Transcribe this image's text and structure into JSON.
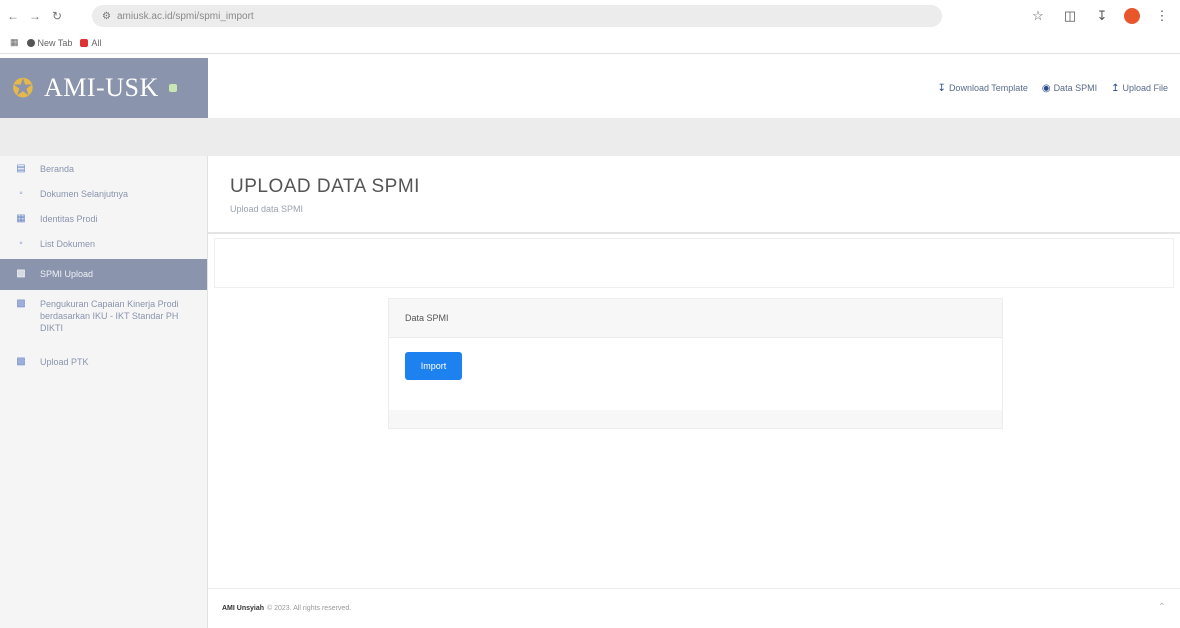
{
  "browser": {
    "url": "amiusk.ac.id/spmi/spmi_import",
    "bookmarks": [
      {
        "label": "New Tab"
      },
      {
        "label": "All"
      }
    ]
  },
  "brand": {
    "name": "AMI-USK"
  },
  "topnav": {
    "download_template": "Download Template",
    "data_spmi": "Data SPMI",
    "upload_file": "Upload File"
  },
  "sidebar": {
    "items": [
      {
        "label": "Beranda",
        "icon": "chart-icon"
      },
      {
        "label": "Dokumen Selanjutnya",
        "icon": "document-icon"
      },
      {
        "label": "Identitas Prodi",
        "icon": "id-card-icon"
      },
      {
        "label": "List Dokumen",
        "icon": "document-icon"
      },
      {
        "label": "SPMI Upload",
        "icon": "calendar-icon"
      },
      {
        "label": "Pengukuran Capaian Kinerja Prodi berdasarkan IKU - IKT Standar PH DIKTI",
        "icon": "calendar-icon"
      },
      {
        "label": "Upload PTK",
        "icon": "calendar-icon"
      }
    ]
  },
  "page": {
    "title": "UPLOAD DATA SPMI",
    "subtitle": "Upload data SPMI"
  },
  "card": {
    "header": "Data SPMI",
    "import_label": "Import"
  },
  "footer": {
    "brand": "AMI Unsyiah",
    "text": "© 2023. All rights reserved."
  },
  "colors": {
    "brand_bg": "#8a94ad",
    "primary_button": "#1d82f0",
    "logo": "#e6b84a"
  }
}
